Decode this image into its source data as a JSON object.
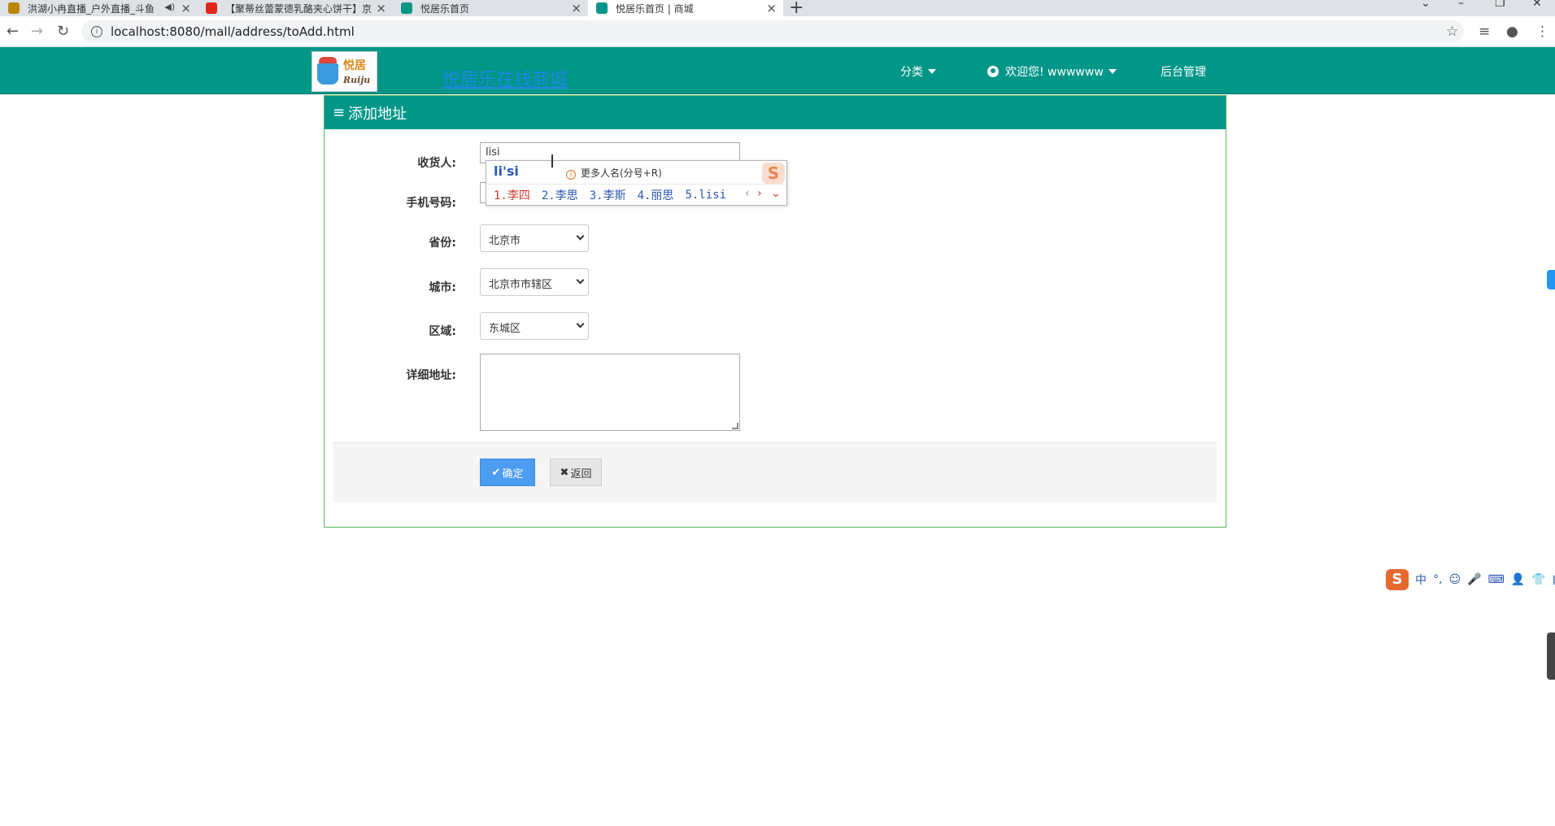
{
  "browser": {
    "tabs": [
      {
        "title": "洪湖小冉直播_户外直播_斗鱼",
        "favicon_color": "#b8860b"
      },
      {
        "title": "【聚蒂丝蕾蒙德乳酪夹心饼干】京",
        "favicon_color": "#e1251b"
      },
      {
        "title": "悦居乐首页",
        "favicon_color": "#009688"
      },
      {
        "title": "悦居乐首页 | 商城",
        "favicon_color": "#009688"
      }
    ],
    "new_tab": "+",
    "url": "localhost:8080/mall/address/toAdd.html"
  },
  "header": {
    "logo_text_top": "悦居",
    "logo_text_bottom": "Ruiju",
    "site_title": "悦居乐在线商城",
    "nav": {
      "category": "分类",
      "welcome": "欢迎您! wwwwww",
      "admin": "后台管理"
    }
  },
  "form": {
    "title": "添加地址",
    "receiver_label": "收货人:",
    "receiver_value": "lisi",
    "phone_label": "手机号码:",
    "province_label": "省份:",
    "province_value": "北京市",
    "city_label": "城市:",
    "city_value": "北京市市辖区",
    "district_label": "区域:",
    "district_value": "东城区",
    "detail_label": "详细地址:",
    "confirm_label": "确定",
    "back_label": "返回"
  },
  "ime": {
    "composition": "li'si",
    "hint": "更多人名(分号+R)",
    "candidates": [
      "1.李四",
      "2.李思",
      "3.李斯",
      "4.丽思",
      "5.lisi"
    ],
    "logo": "S",
    "status_bar": [
      "中",
      "°,",
      "☺",
      "🎤",
      "⌨",
      "👤",
      "👕",
      "▦"
    ]
  },
  "colors": {
    "header_bg": "#009688",
    "confirm_bg": "#4c9cf0",
    "panel_border": "#5cb85c"
  }
}
